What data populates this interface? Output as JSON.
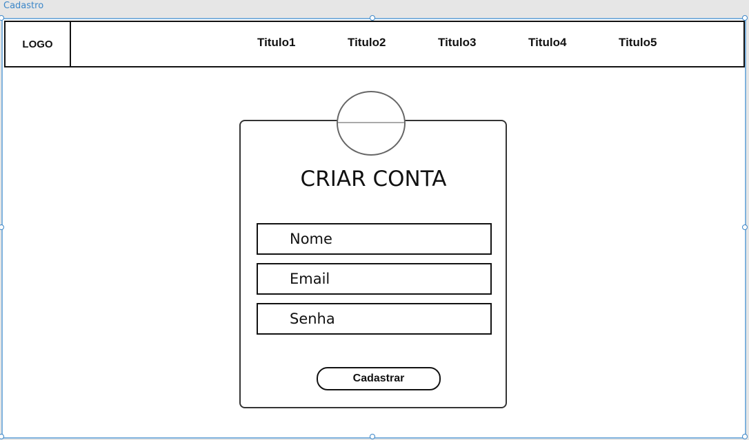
{
  "frame": {
    "label": "Cadastro",
    "accent_color": "#3b86c8"
  },
  "header": {
    "logo": "LOGO",
    "nav": [
      "Titulo1",
      "Titulo2",
      "Titulo3",
      "Titulo4",
      "Titulo5"
    ]
  },
  "form": {
    "title": "CRIAR CONTA",
    "fields": {
      "name_placeholder": "Nome",
      "email_placeholder": "Email",
      "password_placeholder": "Senha"
    },
    "submit_label": "Cadastrar"
  }
}
